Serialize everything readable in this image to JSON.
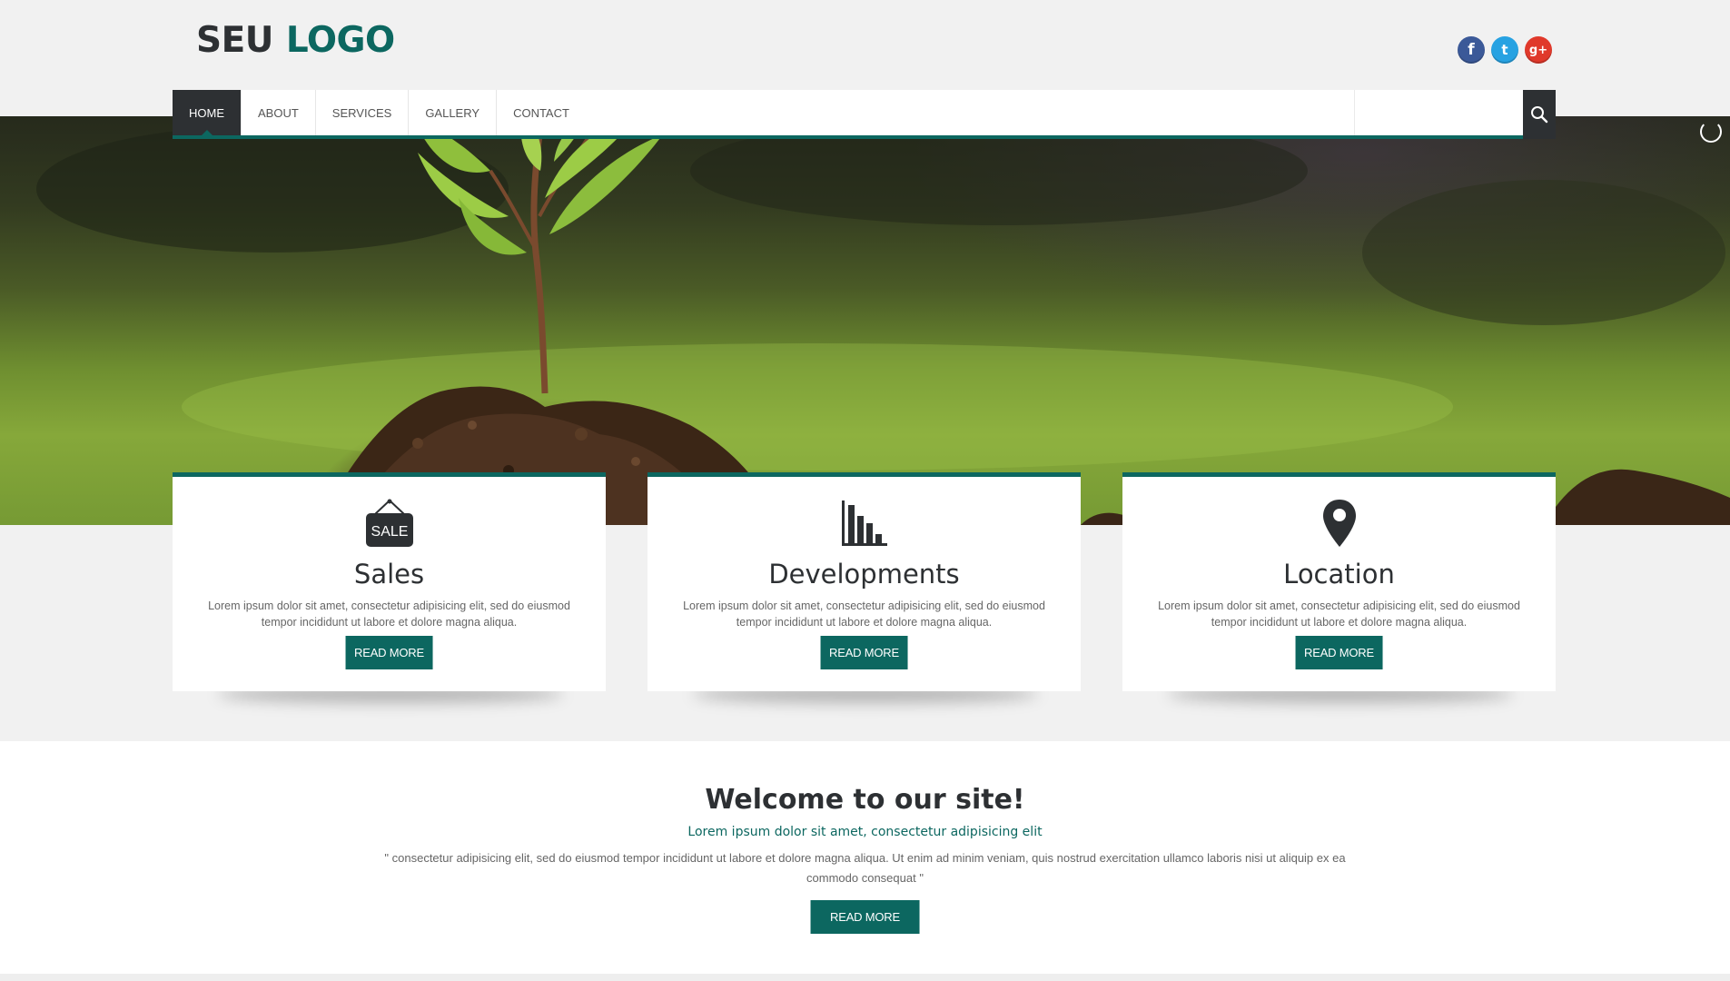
{
  "logo": {
    "part1": "SEU",
    "part2": "LOGO"
  },
  "social": [
    {
      "name": "facebook",
      "glyph": "f"
    },
    {
      "name": "twitter",
      "glyph": "t"
    },
    {
      "name": "google-plus",
      "glyph": "g+"
    }
  ],
  "nav": {
    "items": [
      {
        "label": "HOME",
        "active": true
      },
      {
        "label": "ABOUT"
      },
      {
        "label": "SERVICES"
      },
      {
        "label": "GALLERY"
      },
      {
        "label": "CONTACT"
      }
    ],
    "search_placeholder": ""
  },
  "cards": [
    {
      "icon": "sale-tag-icon",
      "icon_text": "SALE",
      "title": "Sales",
      "text": "Lorem ipsum dolor sit amet, consectetur adipisicing elit, sed do eiusmod tempor incididunt ut labore et dolore magna aliqua.",
      "button": "READ MORE"
    },
    {
      "icon": "bar-chart-icon",
      "title": "Developments",
      "text": "Lorem ipsum dolor sit amet, consectetur adipisicing elit, sed do eiusmod tempor incididunt ut labore et dolore magna aliqua.",
      "button": "READ MORE"
    },
    {
      "icon": "map-pin-icon",
      "title": "Location",
      "text": "Lorem ipsum dolor sit amet, consectetur adipisicing elit, sed do eiusmod tempor incididunt ut labore et dolore magna aliqua.",
      "button": "READ MORE"
    }
  ],
  "welcome": {
    "heading": "Welcome to our site!",
    "subheading": "Lorem ipsum dolor sit amet, consectetur adipisicing elit",
    "quote": "\" consectetur adipisicing elit, sed do eiusmod tempor incididunt ut labore et dolore magna aliqua. Ut enim ad minim veniam, quis nostrud exercitation ullamco laboris nisi ut aliquip ex ea commodo consequat \"",
    "button": "READ MORE"
  },
  "colors": {
    "accent": "#0c6760",
    "dark": "#2d3033",
    "background": "#f1f1f1"
  }
}
